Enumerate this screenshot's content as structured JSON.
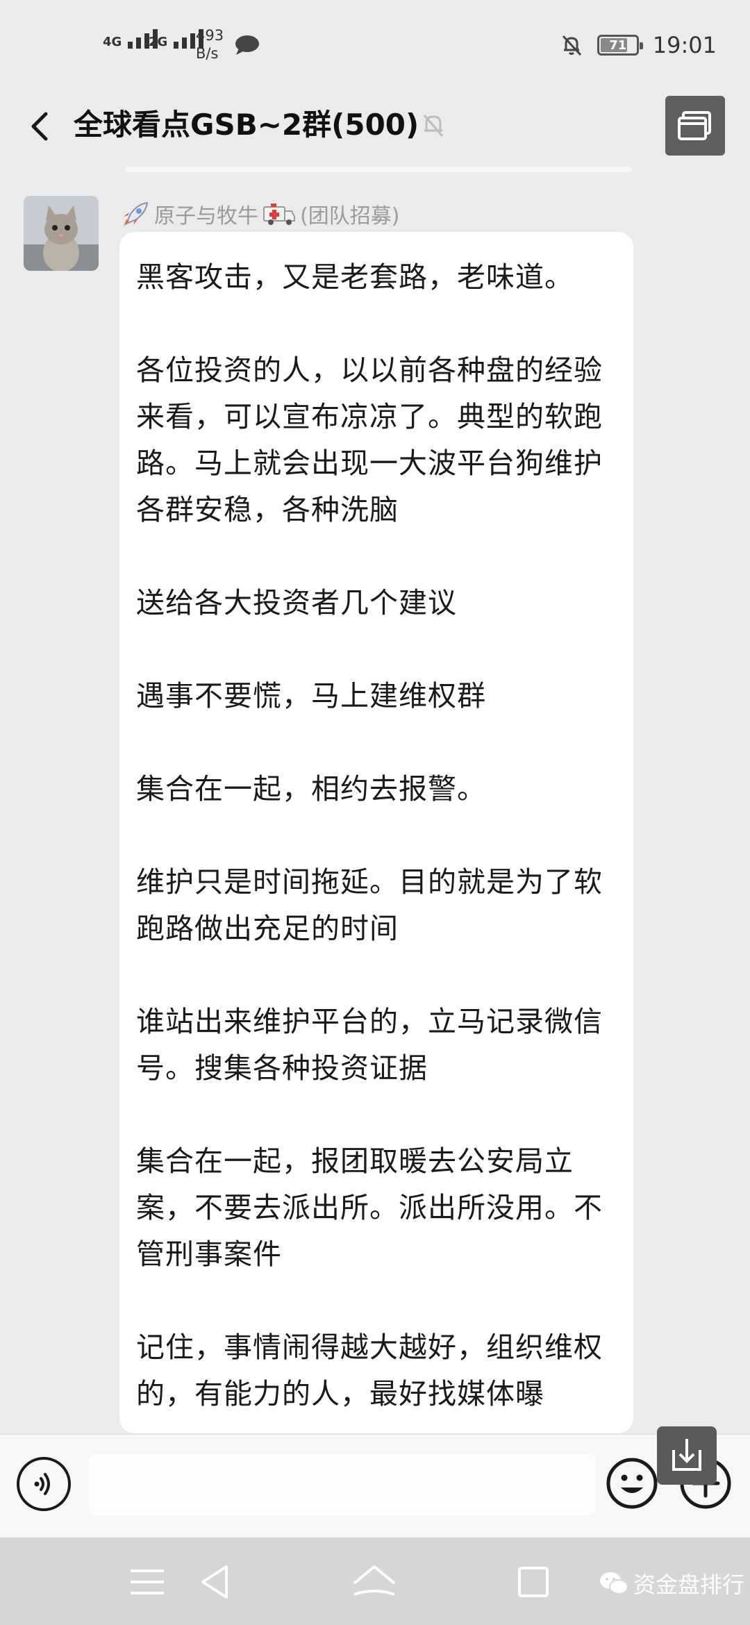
{
  "status_bar": {
    "sim1_label": "4G",
    "sim2_label": "2G",
    "speed_value": "493",
    "speed_unit": "B/s",
    "battery": "71",
    "time": "19:01"
  },
  "header": {
    "title": "全球看点GSB~2群(500)"
  },
  "message": {
    "sender_name": "原子与牧牛",
    "sender_tag": "(团队招募)",
    "paragraphs": [
      "黑客攻击，又是老套路，老味道。",
      "各位投资的人，以以前各种盘的经验来看，可以宣布凉凉了。典型的软跑路。马上就会出现一大波平台狗维护各群安稳，各种洗脑",
      "送给各大投资者几个建议",
      "遇事不要慌，马上建维权群",
      "集合在一起，相约去报警。",
      "维护只是时间拖延。目的就是为了软跑路做出充足的时间",
      "谁站出来维护平台的，立马记录微信号。搜集各种投资证据",
      "集合在一起，报团取暖去公安局立案，不要去派出所。派出所没用。不管刑事案件",
      "记住，事情闹得越大越好，组织维权的，有能力的人，最好找媒体曝"
    ]
  },
  "input": {
    "placeholder": ""
  },
  "watermark": {
    "text": "资金盘排行"
  },
  "icons": {
    "back": "chevron-left-icon",
    "mute": "bell-off-icon",
    "window": "window-icon",
    "voice": "voice-icon",
    "emoji": "emoji-icon",
    "add": "plus-icon",
    "download": "download-icon",
    "rocket": "rocket-icon",
    "ambulance": "ambulance-icon"
  }
}
